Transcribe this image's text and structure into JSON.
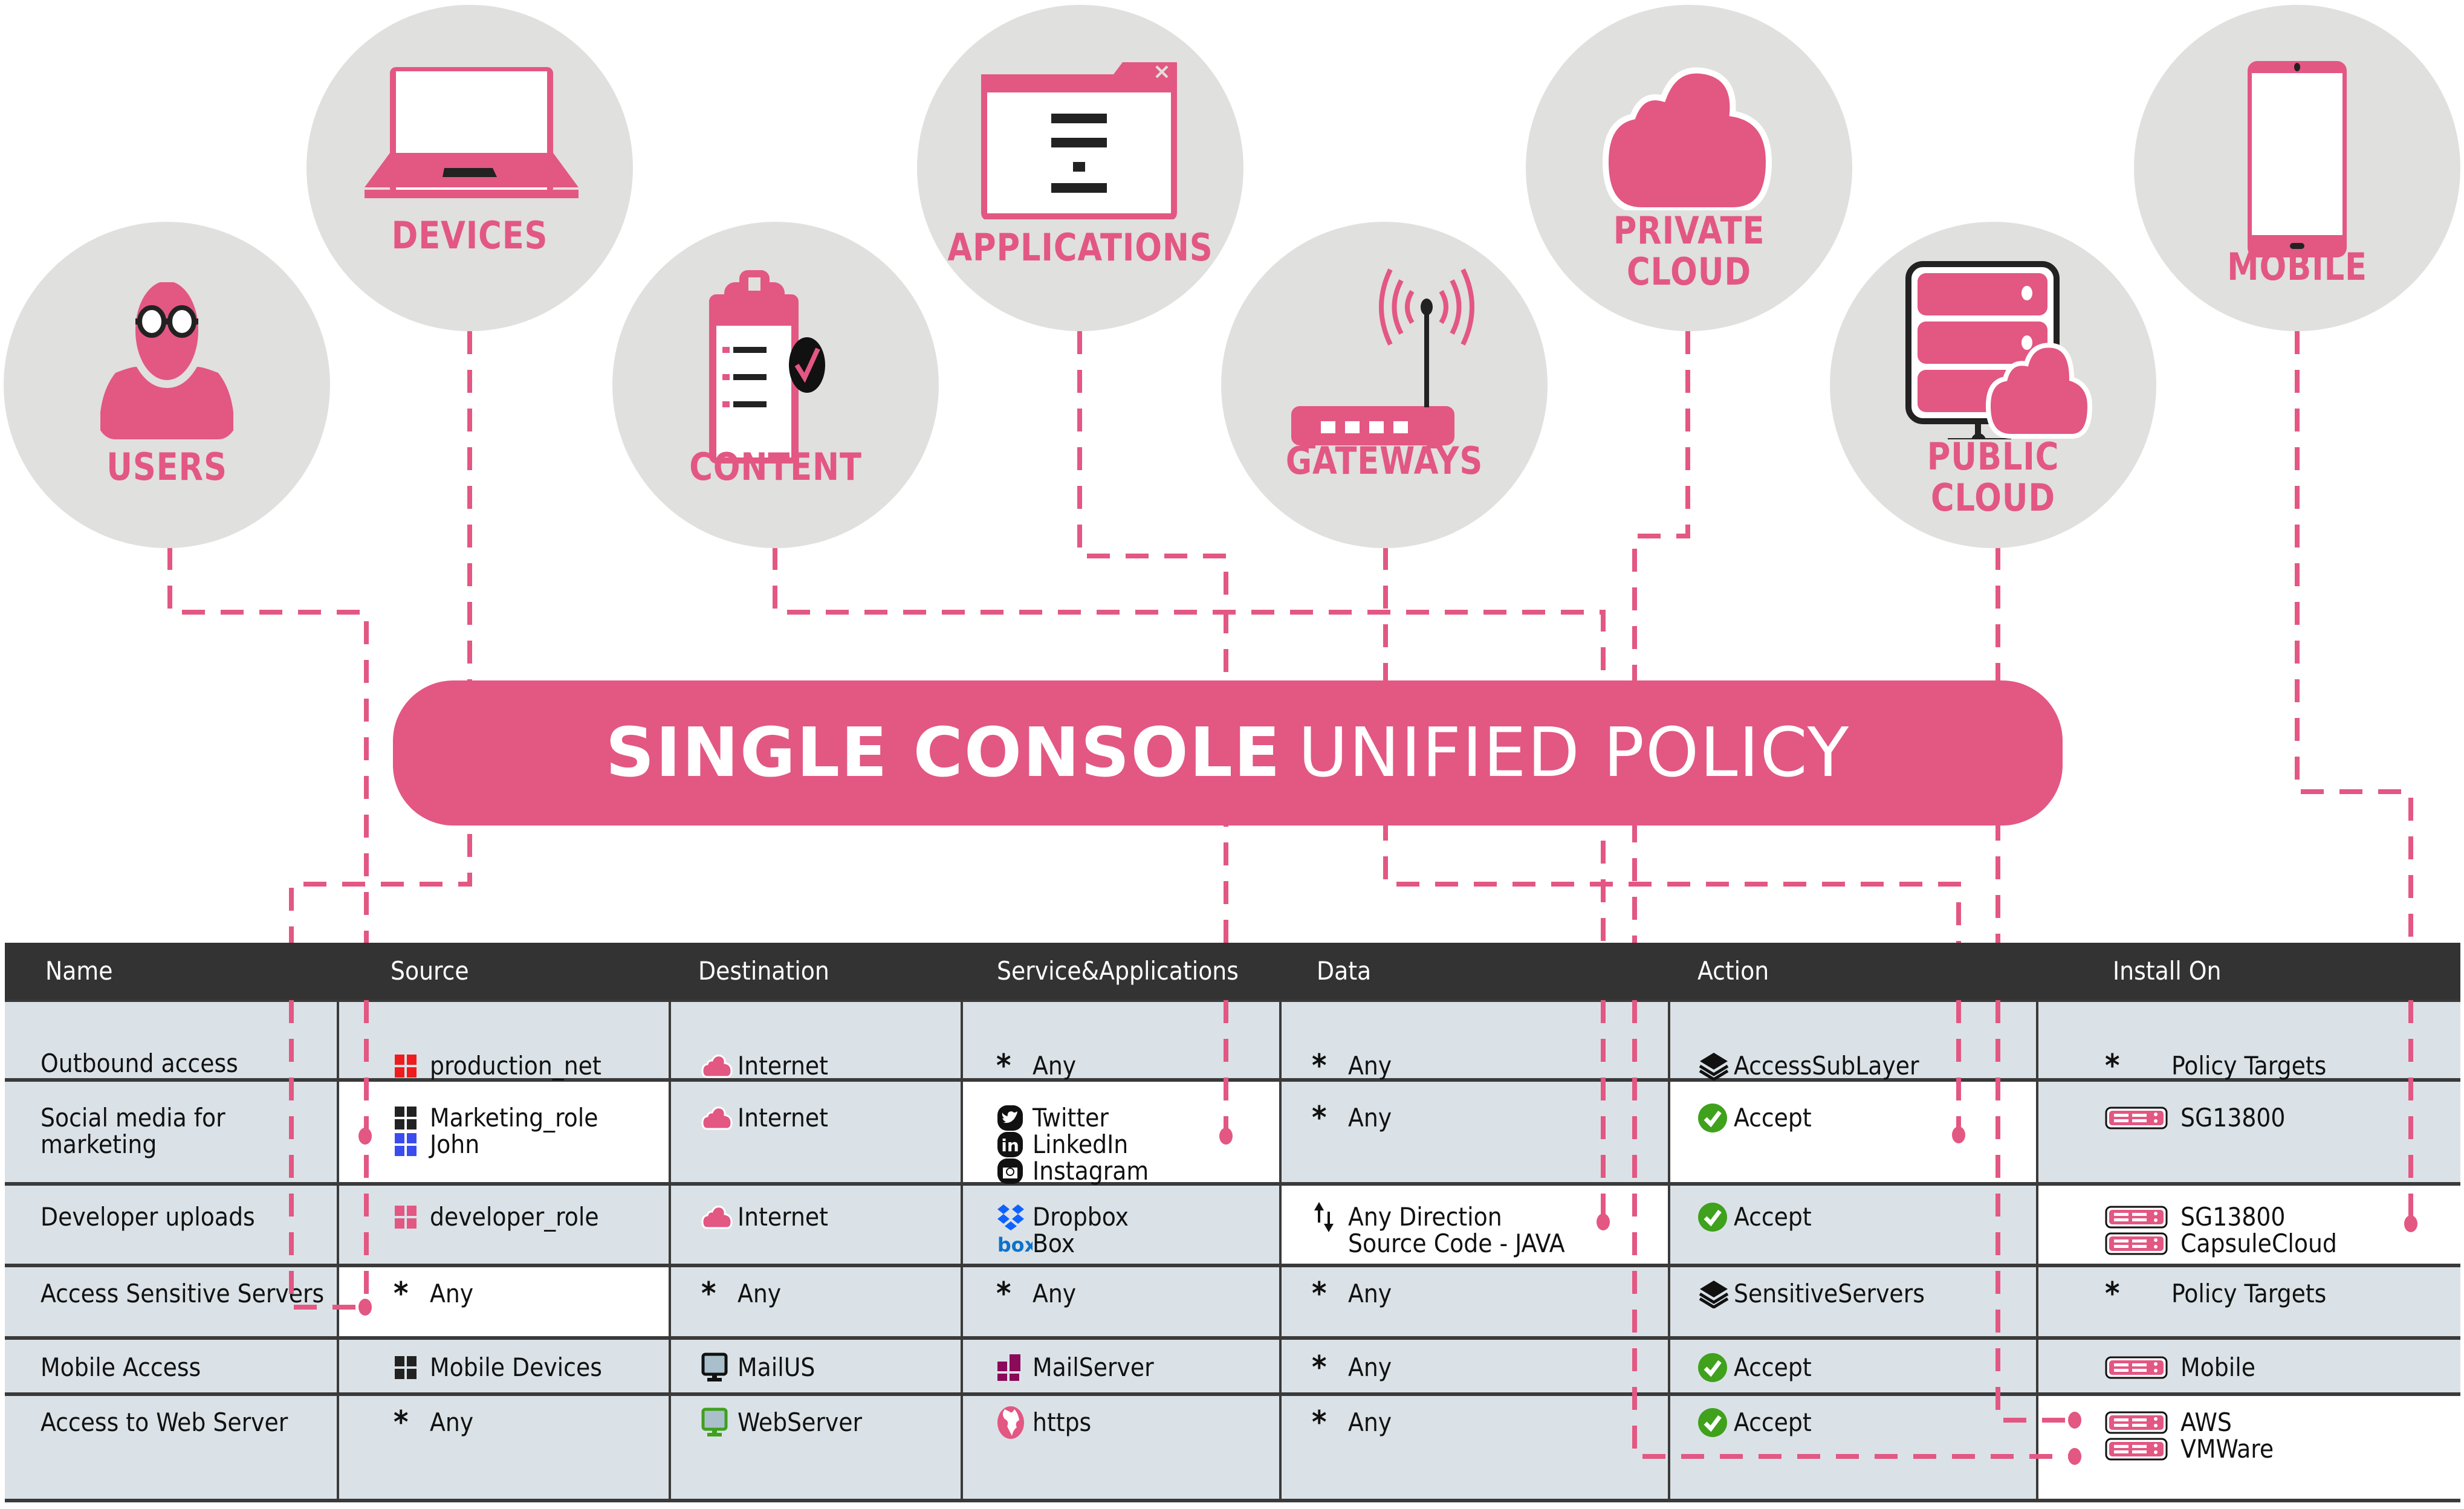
{
  "colors": {
    "accent": "#e35783",
    "circle_bg": "#e0e0de",
    "table_header_bg": "#333333",
    "row_bg": "#dae2e7",
    "accept_green": "#3fa11c"
  },
  "categories": [
    {
      "id": "users",
      "label": "USERS",
      "icon": "user-icon"
    },
    {
      "id": "devices",
      "label": "DEVICES",
      "icon": "laptop-icon"
    },
    {
      "id": "content",
      "label": "CONTENT",
      "icon": "clipboard-check-icon"
    },
    {
      "id": "applications",
      "label": "APPLICATIONS",
      "icon": "app-window-icon"
    },
    {
      "id": "gateways",
      "label": "GATEWAYS",
      "icon": "router-icon"
    },
    {
      "id": "private_cloud",
      "label_line1": "PRIVATE",
      "label_line2": "CLOUD",
      "icon": "cloud-icon"
    },
    {
      "id": "public_cloud",
      "label_line1": "PUBLIC",
      "label_line2": "CLOUD",
      "icon": "server-cloud-icon"
    },
    {
      "id": "mobile",
      "label": "MOBILE",
      "icon": "smartphone-icon"
    }
  ],
  "banner": {
    "bold": "SINGLE CONSOLE",
    "regular": "UNIFIED POLICY"
  },
  "table": {
    "columns": [
      "Name",
      "Source",
      "Destination",
      "Service&Applications",
      "Data",
      "Action",
      "Install On"
    ],
    "rows": [
      {
        "name": "Outbound access",
        "source": [
          {
            "icon": "network-red-icon",
            "text": "production_net"
          }
        ],
        "destination": [
          {
            "icon": "cloud-icon",
            "text": "Internet"
          }
        ],
        "service": [
          {
            "icon": "asterisk-icon",
            "text": "Any"
          }
        ],
        "data": [
          {
            "icon": "asterisk-icon",
            "text": "Any"
          }
        ],
        "action": [
          {
            "icon": "layers-icon",
            "text": "AccessSubLayer"
          }
        ],
        "install_on": [
          {
            "icon": "asterisk-icon",
            "text": "Policy Targets"
          }
        ]
      },
      {
        "name": "Social media for marketing",
        "source": [
          {
            "icon": "role-black-icon",
            "text": "Marketing_role"
          },
          {
            "icon": "user-blue-icon",
            "text": "John"
          }
        ],
        "destination": [
          {
            "icon": "cloud-icon",
            "text": "Internet"
          }
        ],
        "service": [
          {
            "icon": "twitter-icon",
            "text": "Twitter"
          },
          {
            "icon": "linkedin-icon",
            "text": "LinkedIn"
          },
          {
            "icon": "instagram-icon",
            "text": "Instagram"
          }
        ],
        "data": [
          {
            "icon": "asterisk-icon",
            "text": "Any"
          }
        ],
        "action": [
          {
            "icon": "accept-check-icon",
            "text": "Accept"
          }
        ],
        "install_on": [
          {
            "icon": "gateway-appliance-icon",
            "text": "SG13800"
          }
        ]
      },
      {
        "name": "Developer uploads",
        "source": [
          {
            "icon": "role-pink-icon",
            "text": "developer_role"
          }
        ],
        "destination": [
          {
            "icon": "cloud-icon",
            "text": "Internet"
          }
        ],
        "service": [
          {
            "icon": "dropbox-icon",
            "text": "Dropbox"
          },
          {
            "icon": "box-icon",
            "text": "Box"
          }
        ],
        "data": [
          {
            "icon": "direction-arrows-icon",
            "text": "Any Direction"
          },
          {
            "icon": "",
            "text": "Source Code - JAVA"
          }
        ],
        "action": [
          {
            "icon": "accept-check-icon",
            "text": "Accept"
          }
        ],
        "install_on": [
          {
            "icon": "gateway-appliance-icon",
            "text": "SG13800"
          },
          {
            "icon": "gateway-appliance-icon",
            "text": "CapsuleCloud"
          }
        ]
      },
      {
        "name": "Access Sensitive Servers",
        "source": [
          {
            "icon": "asterisk-icon",
            "text": "Any"
          }
        ],
        "destination": [
          {
            "icon": "asterisk-icon",
            "text": "Any"
          }
        ],
        "service": [
          {
            "icon": "asterisk-icon",
            "text": "Any"
          }
        ],
        "data": [
          {
            "icon": "asterisk-icon",
            "text": "Any"
          }
        ],
        "action": [
          {
            "icon": "layers-icon",
            "text": "SensitiveServers"
          }
        ],
        "install_on": [
          {
            "icon": "asterisk-icon",
            "text": "Policy Targets"
          }
        ]
      },
      {
        "name": "Mobile Access",
        "source": [
          {
            "icon": "role-black-icon",
            "text": "Mobile Devices"
          }
        ],
        "destination": [
          {
            "icon": "host-black-icon",
            "text": "MailUS"
          }
        ],
        "service": [
          {
            "icon": "mail-server-icon",
            "text": "MailServer"
          }
        ],
        "data": [
          {
            "icon": "asterisk-icon",
            "text": "Any"
          }
        ],
        "action": [
          {
            "icon": "accept-check-icon",
            "text": "Accept"
          }
        ],
        "install_on": [
          {
            "icon": "gateway-appliance-icon",
            "text": "Mobile"
          }
        ]
      },
      {
        "name": "Access to Web Server",
        "source": [
          {
            "icon": "asterisk-icon",
            "text": "Any"
          }
        ],
        "destination": [
          {
            "icon": "host-green-icon",
            "text": "WebServer"
          }
        ],
        "service": [
          {
            "icon": "globe-icon",
            "text": "https"
          }
        ],
        "data": [
          {
            "icon": "asterisk-icon",
            "text": "Any"
          }
        ],
        "action": [
          {
            "icon": "accept-check-icon",
            "text": "Accept"
          }
        ],
        "install_on": [
          {
            "icon": "gateway-appliance-icon",
            "text": "AWS"
          },
          {
            "icon": "gateway-appliance-icon",
            "text": "VMWare"
          }
        ]
      }
    ]
  }
}
